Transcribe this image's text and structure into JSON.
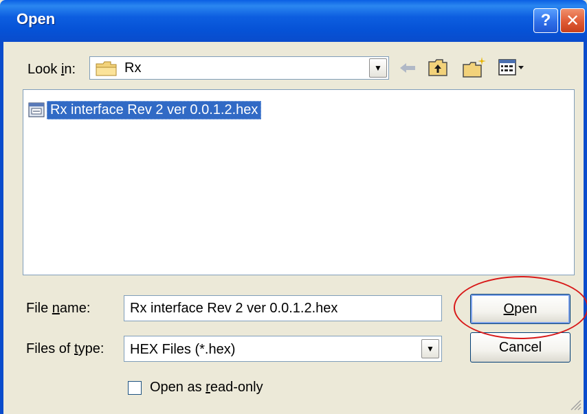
{
  "window": {
    "title": "Open",
    "help_icon": "?",
    "close_icon": "✕"
  },
  "look_in": {
    "label_prefix": "Look ",
    "label_accel": "i",
    "label_suffix": "n:",
    "value": "Rx",
    "folder_icon": "folder-icon"
  },
  "toolbar": {
    "icons": [
      "back-icon",
      "up-folder-icon",
      "new-folder-icon",
      "views-menu-icon"
    ]
  },
  "file_list": {
    "items": [
      {
        "name": "Rx interface Rev 2 ver 0.0.1.2.hex",
        "selected": true,
        "icon": "hex-file-icon"
      }
    ]
  },
  "file_name": {
    "label_prefix": "File ",
    "label_accel": "n",
    "label_suffix": "ame:",
    "value": "Rx interface Rev 2 ver 0.0.1.2.hex"
  },
  "file_type": {
    "label_prefix": "Files of ",
    "label_accel": "t",
    "label_suffix": "ype:",
    "value": "HEX Files (*.hex)"
  },
  "buttons": {
    "open_accel": "O",
    "open_rest": "pen",
    "cancel_label": "Cancel"
  },
  "read_only": {
    "label_prefix": "Open as ",
    "label_accel": "r",
    "label_suffix": "ead-only",
    "checked": false
  },
  "colors": {
    "title_bar": "#0a4ccc",
    "selection": "#316ac5",
    "annotation": "#d81818"
  }
}
